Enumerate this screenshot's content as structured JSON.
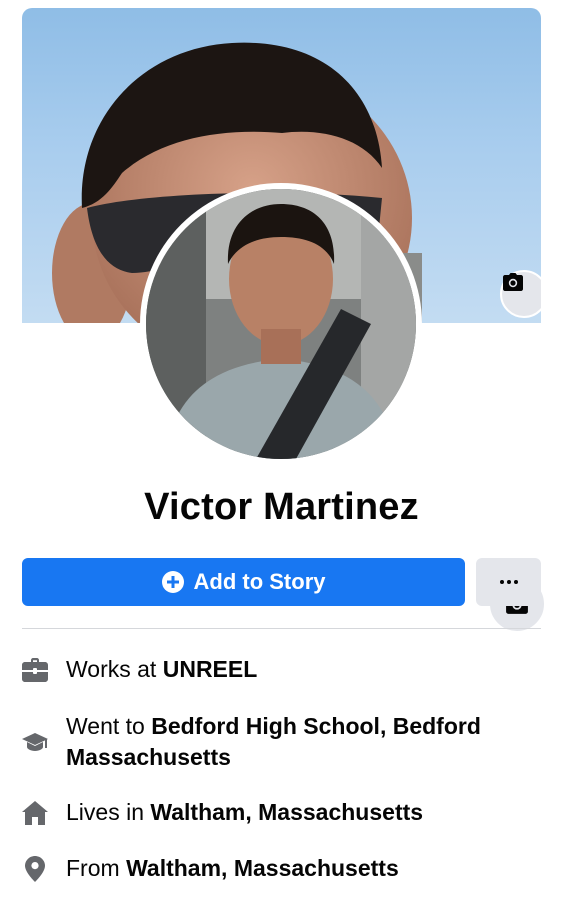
{
  "profile": {
    "name": "Victor Martinez"
  },
  "actions": {
    "add_story_label": "Add to Story",
    "more_label": "···"
  },
  "details": [
    {
      "icon": "briefcase-icon",
      "prefix": "Works at ",
      "value": "UNREEL"
    },
    {
      "icon": "graduation-cap-icon",
      "prefix": "Went to ",
      "value": "Bedford High School, Bedford Massachusetts"
    },
    {
      "icon": "home-icon",
      "prefix": "Lives in ",
      "value": "Waltham, Massachusetts"
    },
    {
      "icon": "location-pin-icon",
      "prefix": "From ",
      "value": "Waltham, Massachusetts"
    }
  ],
  "colors": {
    "primary": "#1877f2",
    "secondary_button": "#e4e6eb",
    "icon": "#65676b",
    "text": "#050505"
  }
}
